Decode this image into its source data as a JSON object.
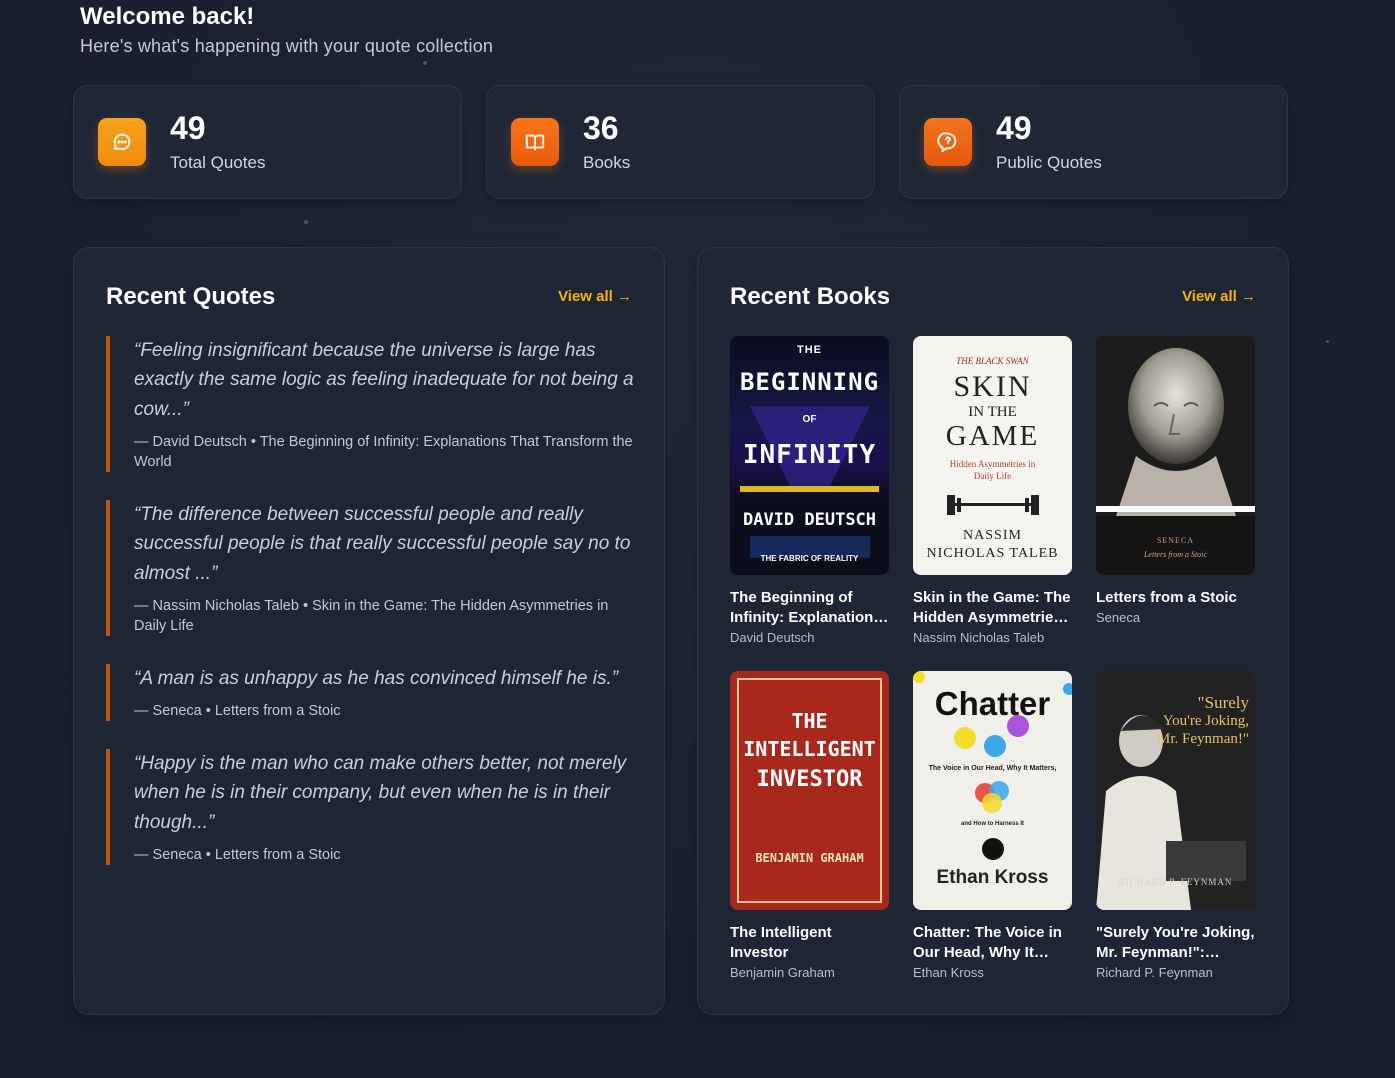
{
  "header": {
    "title": "Welcome back!",
    "subtitle": "Here's what's happening with your quote collection"
  },
  "stats": [
    {
      "value": "49",
      "label": "Total Quotes",
      "icon": "chat-bubble-icon",
      "color": "#f39c12"
    },
    {
      "value": "36",
      "label": "Books",
      "icon": "open-book-icon",
      "color": "#f07010"
    },
    {
      "value": "49",
      "label": "Public Quotes",
      "icon": "globe-chat-icon",
      "color": "#ee6a12"
    }
  ],
  "recent_quotes": {
    "title": "Recent Quotes",
    "view_all": "View all →",
    "items": [
      {
        "text": "“Feeling insignificant because the universe is large has exactly the same logic as feeling inadequate for not being a cow...”",
        "meta": "— David Deutsch • The Beginning of Infinity: Explanations That Transform the World"
      },
      {
        "text": "“The difference between successful people and really successful people is that really successful people say no to almost ...”",
        "meta": "— Nassim Nicholas Taleb • Skin in the Game: The Hidden Asymmetries in Daily Life"
      },
      {
        "text": "“A man is as unhappy as he has convinced himself he is.”",
        "meta": "— Seneca • Letters from a Stoic"
      },
      {
        "text": "“Happy is the man who can make others better, not merely when he is in their company, but even when he is in their though...”",
        "meta": "— Seneca • Letters from a Stoic"
      }
    ]
  },
  "recent_books": {
    "title": "Recent Books",
    "view_all": "View all →",
    "items": [
      {
        "title": "The Beginning of Infinity: Explanations That Transform the World",
        "author": "David Deutsch",
        "cover": {
          "l1": "THE",
          "l2": "BEGINNING",
          "l3": "OF",
          "l4": "INFINITY",
          "l5": "DAVID DEUTSCH",
          "l6": "THE FABRIC OF REALITY"
        }
      },
      {
        "title": "Skin in the Game: The Hidden Asymmetries in Daily Life",
        "author": "Nassim Nicholas Taleb",
        "cover": {
          "l1": "THE BLACK SWAN",
          "l2": "SKIN",
          "l3": "IN THE",
          "l4": "GAME",
          "l5": "Hidden Asymmetries in Daily Life",
          "l6": "NASSIM",
          "l7": "NICHOLAS TALEB"
        }
      },
      {
        "title": "Letters from a Stoic",
        "author": "Seneca",
        "cover": {
          "l1": "SENECA",
          "l2": "Letters from a Stoic"
        }
      },
      {
        "title": "The Intelligent Investor",
        "author": "Benjamin Graham",
        "cover": {
          "l1": "THE",
          "l2": "INTELLIGENT",
          "l3": "INVESTOR",
          "l4": "BENJAMIN GRAHAM"
        }
      },
      {
        "title": "Chatter: The Voice in Our Head, Why It Matters, and How to Harness It",
        "author": "Ethan Kross",
        "cover": {
          "l1": "Chatter",
          "l2": "The Voice in Our Head, Why It Matters,",
          "l3": "and How to Harness It",
          "l4": "Ethan Kross"
        }
      },
      {
        "title": "\"Surely You're Joking, Mr. Feynman!\": Adventures of a Curious Character",
        "author": "Richard P. Feynman",
        "cover": {
          "l1": "\"Surely",
          "l2": "You're Joking,",
          "l3": "Mr. Feynman!\"",
          "l4": "RICHARD P. FEYNMAN"
        }
      }
    ]
  }
}
